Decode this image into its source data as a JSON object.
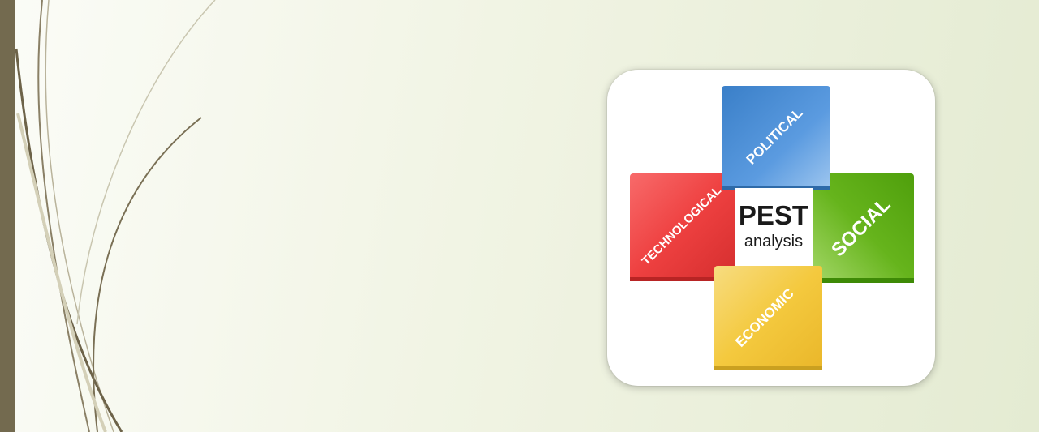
{
  "slide": {
    "background_colors": [
      "#fbfcf7",
      "#e4ebd2"
    ],
    "accent_bar_color": "#736a4f"
  },
  "pest": {
    "center_title": "PEST",
    "center_subtitle": "analysis",
    "blocks": {
      "political": {
        "label": "POLITICAL",
        "color": "#4a90d6"
      },
      "technological": {
        "label": "TECHNOLOGICAL",
        "color": "#f04848"
      },
      "social": {
        "label": "SOCIAL",
        "color": "#5aae14"
      },
      "economic": {
        "label": "ECONOMIC",
        "color": "#f2c63c"
      }
    }
  }
}
